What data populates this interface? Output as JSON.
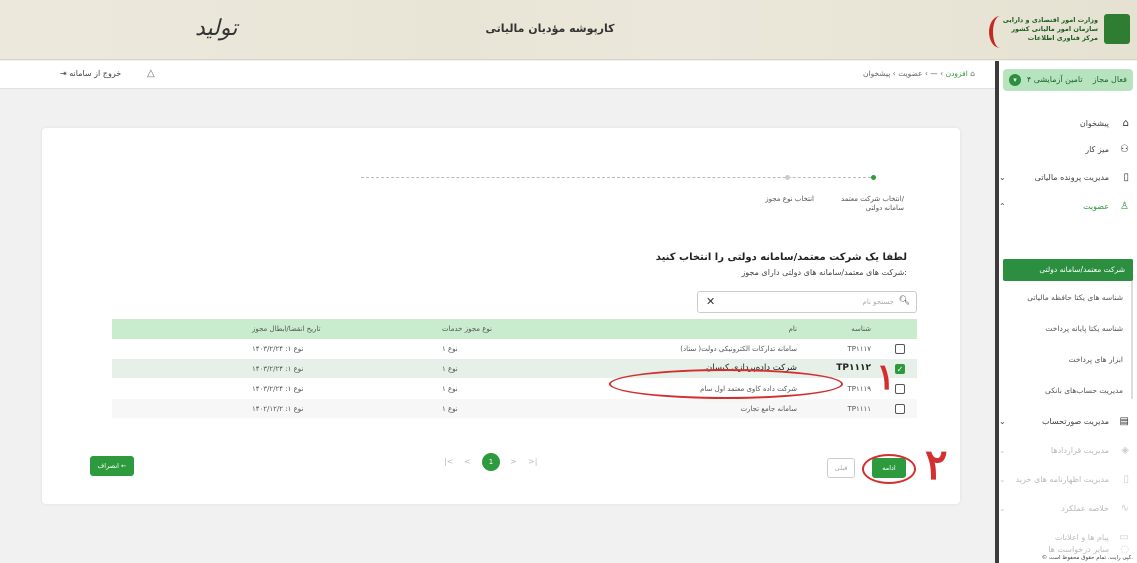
{
  "header": {
    "title": "کارپوشه مؤدیان مالیاتی",
    "left_logo_text": "تولید",
    "org_line1": "وزارت امور اقتصادی و دارایی",
    "org_line2": "سازمان امور مالیاتی کشور",
    "org_line3": "مرکز فناوری اطلاعات"
  },
  "topbar": {
    "exit_label": "خروج از سامانه",
    "breadcrumb": {
      "home": "پیشخوان",
      "sep1": "›",
      "membership": "عضویت",
      "sep2": "›",
      "dash": "—",
      "sep3": "›",
      "current": "افزودن"
    }
  },
  "sidebar": {
    "profile_name": "تامین آزمایشی ۴",
    "profile_status": "فعال مجاز",
    "items": [
      {
        "label": "پیشخوان"
      },
      {
        "label": "میز کار"
      },
      {
        "label": "مدیریت پرونده مالیاتی"
      },
      {
        "label": "عضویت"
      },
      {
        "label": "مدیریت صورتحساب"
      },
      {
        "label": "مدیریت قراردادها"
      },
      {
        "label": "مدیریت اظهارنامه های خرید"
      },
      {
        "label": "خلاصه عملکرد"
      },
      {
        "label": "پیام ها و اعلانات"
      },
      {
        "label": "سایر درخواست ها"
      }
    ],
    "subitems": [
      {
        "label": "شرکت معتمد/سامانه دولتی"
      },
      {
        "label": "شناسه های یکتا حافظه مالیاتی"
      },
      {
        "label": "شناسه یکتا پایانه پرداخت"
      },
      {
        "label": "ابزار های پرداخت"
      },
      {
        "label": "مدیریت حساب‌های بانکی"
      }
    ],
    "copyright": "© کپی رایت. تمام حقوق محفوظ است."
  },
  "stepper": {
    "step1": "انتخاب شرکت معتمد/",
    "step1b": "سامانه دولتی",
    "step2": "انتخاب نوع مجوز"
  },
  "content": {
    "heading": "لطفا یک شرکت معتمد/سامانه دولتی را انتخاب کنید",
    "subheading": "شرکت های معتمد/سامانه های دولتی دارای مجوز:",
    "search_placeholder": "جستجو نام",
    "search_icon": "search-icon",
    "clear_icon": "close-icon"
  },
  "table": {
    "headers": {
      "code": "شناسه",
      "name": "نام",
      "type": "نوع مجوز خدمات",
      "date": "تاریخ انقضا/ابطال مجوز"
    },
    "rows": [
      {
        "code": "TP۱۱۱۷",
        "name": "سامانه تدارکات الکترونیکی دولت( ستاد)",
        "type": "نوع ۱",
        "date": "نوع ۱: ۱۴۰۳/۲/۲۴",
        "selected": false
      },
      {
        "code": "TP۱۱۱۲",
        "name": "شرکت داده‌پردازی کیسان",
        "type": "نوع ۱",
        "date": "نوع ۱: ۱۴۰۳/۲/۲۴",
        "selected": true
      },
      {
        "code": "TP۱۱۱۹",
        "name": "شرکت داده کاوی معتمد اول سام",
        "type": "نوع ۱",
        "date": "نوع ۱: ۱۴۰۳/۲/۲۴",
        "selected": false
      },
      {
        "code": "TP۱۱۱۱",
        "name": "سامانه جامع تجارت",
        "type": "نوع ۱",
        "date": "نوع ۱: ۱۴۰۲/۱۲/۲",
        "selected": false
      }
    ]
  },
  "pager": {
    "first": "|<",
    "prev": "<",
    "current": "1",
    "next": ">",
    "last": ">|"
  },
  "buttons": {
    "continue": "ادامه",
    "prev": "قبلی",
    "cancel": "انصراف ←"
  },
  "annotations": {
    "one": "۱",
    "two": "۲",
    "color": "#d32f2f"
  },
  "colors": {
    "accent": "#2e9a3e",
    "header_row": "#c9ecce"
  }
}
